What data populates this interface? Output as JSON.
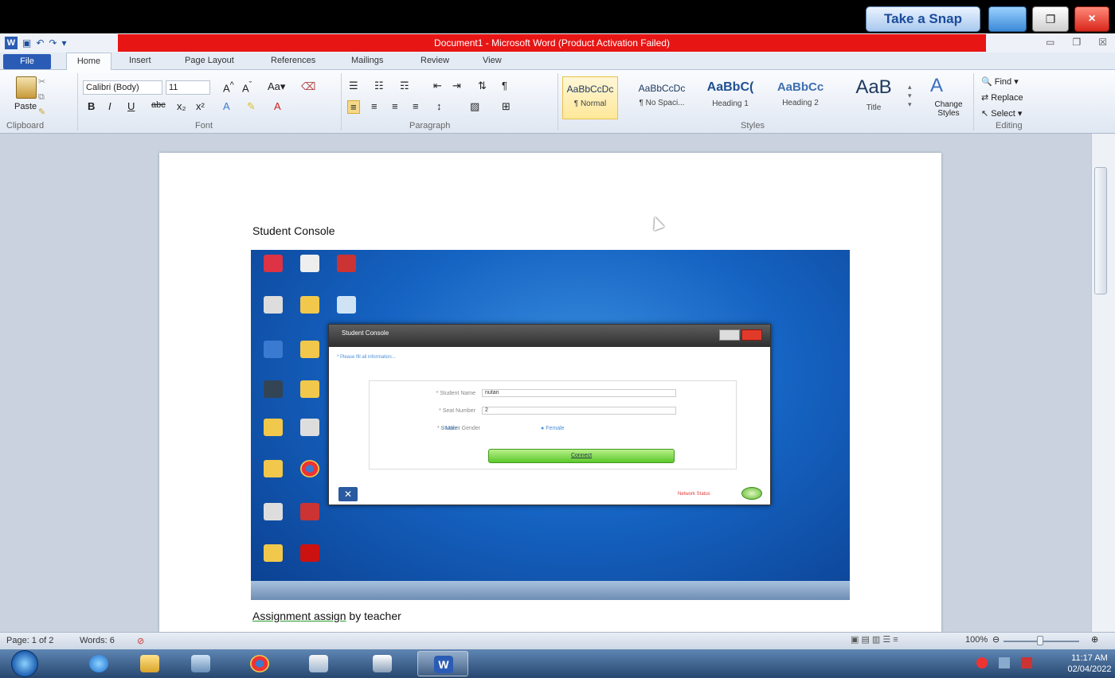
{
  "snap_overlay": {
    "take_snap_label": "Take a Snap",
    "close_glyph": "×",
    "restore_glyph": "❐"
  },
  "window": {
    "title": "Document1  -  Microsoft Word (Product Activation Failed)"
  },
  "ribbon": {
    "tabs": [
      "File",
      "Home",
      "Insert",
      "Page Layout",
      "References",
      "Mailings",
      "Review",
      "View"
    ],
    "clipboard": {
      "paste": "Paste",
      "group": "Clipboard"
    },
    "font": {
      "family": "Calibri (Body)",
      "size": "11",
      "group": "Font"
    },
    "paragraph": {
      "group": "Paragraph"
    },
    "styles": {
      "group": "Styles",
      "items": [
        {
          "sample": "AaBbCcDc",
          "name": "¶ Normal"
        },
        {
          "sample": "AaBbCcDc",
          "name": "¶ No Spaci..."
        },
        {
          "sample": "AaBbC(",
          "name": "Heading 1"
        },
        {
          "sample": "AaBbCc",
          "name": "Heading 2"
        },
        {
          "sample": "AaB",
          "name": "Title"
        }
      ],
      "change_styles": "Change Styles"
    },
    "editing": {
      "find": "Find",
      "replace": "Replace",
      "select": "Select",
      "group": "Editing"
    }
  },
  "document": {
    "heading": "Student Console",
    "footer_underlined": "Assignment assign",
    "footer_rest": " by teacher",
    "embedded_console": {
      "title": "Student Console",
      "note": "* Please fill all information...",
      "fields": [
        {
          "label": "* Student Name",
          "value": "nutan"
        },
        {
          "label": "* Seat Number",
          "value": "2"
        }
      ],
      "gender_label": "* Student Gender",
      "gender_options": [
        "Male",
        "Female"
      ],
      "gender_selected": "Female",
      "connect_label": "Connect",
      "network_status": "Network Status"
    }
  },
  "statusbar": {
    "page": "Page: 1 of 2",
    "words": "Words: 6",
    "zoom": "100%"
  },
  "taskbar": {
    "time": "11:17 AM",
    "date": "02/04/2022"
  },
  "colors": {
    "title_red": "#e81515",
    "word_blue": "#2b5cb5",
    "connect_green": "#5cc82b"
  }
}
